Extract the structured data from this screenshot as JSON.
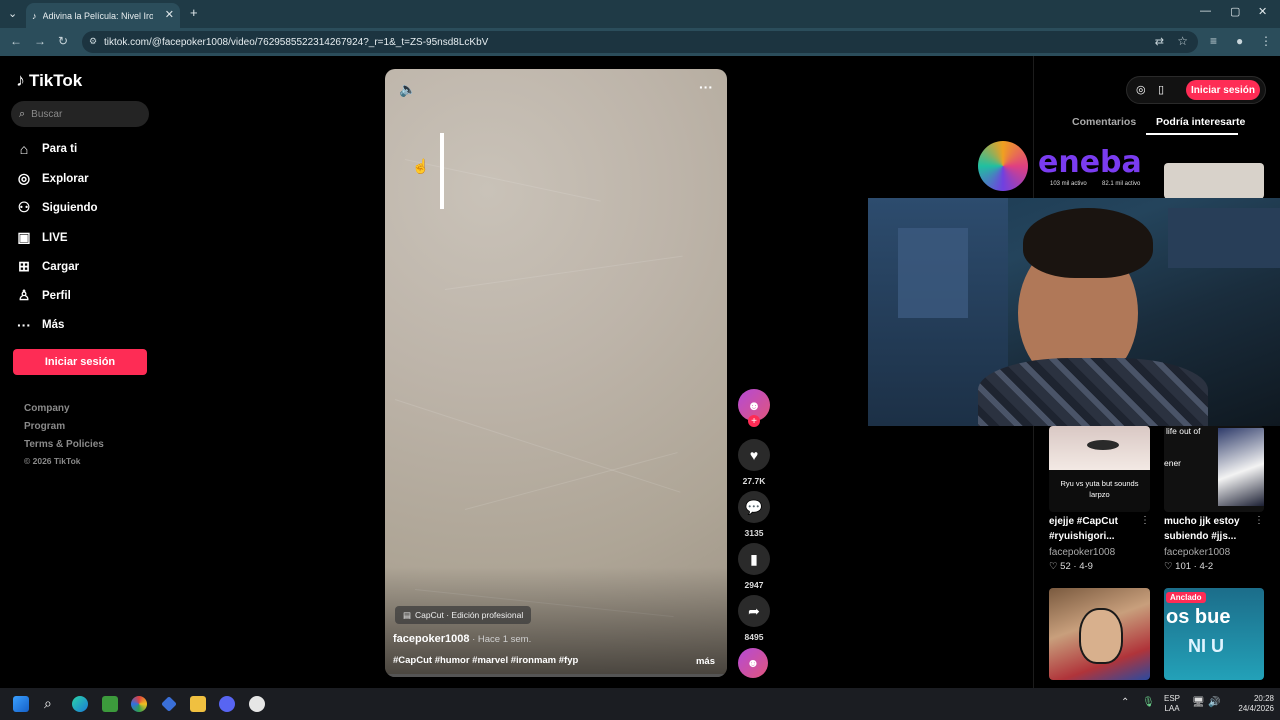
{
  "browser": {
    "tab_title": "Adivina la Película: Nivel Iron M",
    "url": "tiktok.com/@facepoker1008/video/7629585522314267924?_r=1&_t=ZS-95nsd8LcKbV"
  },
  "sidebar": {
    "logo": "TikTok",
    "search_placeholder": "Buscar",
    "items": [
      {
        "label": "Para ti",
        "icon": "home-icon"
      },
      {
        "label": "Explorar",
        "icon": "compass-icon"
      },
      {
        "label": "Siguiendo",
        "icon": "following-icon"
      },
      {
        "label": "LIVE",
        "icon": "live-icon"
      },
      {
        "label": "Cargar",
        "icon": "upload-icon"
      },
      {
        "label": "Perfil",
        "icon": "profile-icon"
      },
      {
        "label": "Más",
        "icon": "more-icon"
      }
    ],
    "login_label": "Iniciar sesión",
    "footer": [
      "Company",
      "Program",
      "Terms & Policies",
      "© 2026 TikTok"
    ]
  },
  "video": {
    "capcut_label": "CapCut · Edición profesional",
    "author": "facepoker1008",
    "ago": " · Hace 1 sem.",
    "hashtags": "#CapCut #humor #marvel #ironmam #fyp",
    "more_label": "más"
  },
  "actions": {
    "likes": "27.7K",
    "comments": "3135",
    "saves": "2947",
    "shares": "8495"
  },
  "right_panel": {
    "login_label": "Iniciar sesión",
    "tabs": [
      "Comentarios",
      "Podría interesarte"
    ],
    "cards": [
      {
        "title_line1": "ejejje #CapCut",
        "title_line2": "#ryuishigori...",
        "user": "facepoker1008",
        "likes": "52",
        "date": "4-9",
        "thumb_text": "Ryu vs yuta but sounds larpzo"
      },
      {
        "title_line1": "mucho jjk estoy",
        "title_line2": "subiendo #jjs...",
        "user": "facepoker1008",
        "likes": "101",
        "date": "4-2",
        "thumb_text_1": "life out of",
        "thumb_text_2": "ener"
      }
    ],
    "pinned_label": "Anclado",
    "pinned_thumb_text": "os bue",
    "pinned_thumb_text2": "NI U"
  },
  "overlay": {
    "brand": "eneba",
    "live_a": "103 mil activo",
    "live_b": "82.1 mil activo"
  },
  "taskbar": {
    "lang_1": "ESP",
    "lang_2": "LAA",
    "time": "20:28",
    "date": "24/4/2026"
  }
}
